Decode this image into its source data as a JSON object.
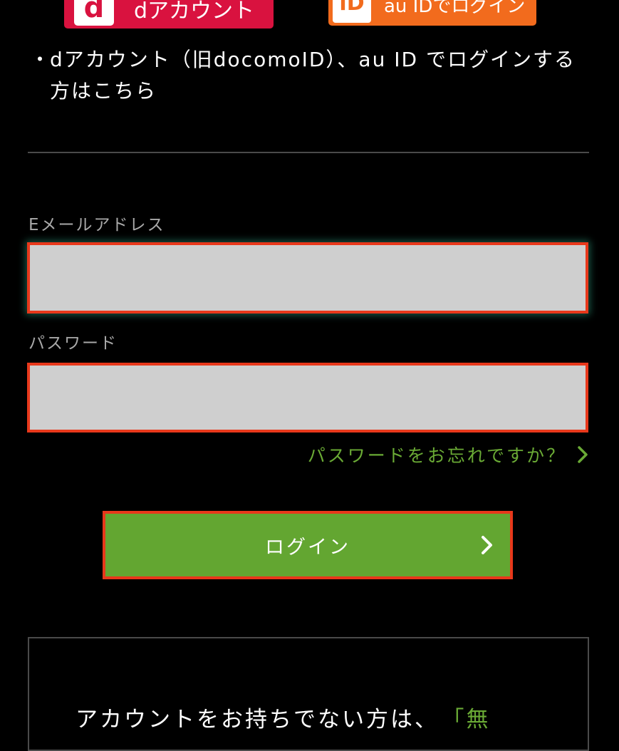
{
  "partner_login": {
    "docomo": {
      "logo_text": "d",
      "label": "dアカウント"
    },
    "au": {
      "logo_text": "iD",
      "label": "au IDでログイン"
    }
  },
  "note": {
    "bullet": "・",
    "text": "dアカウント（旧docomoID）、au ID でログインする方はこちら"
  },
  "form": {
    "email_label": "Eメールアドレス",
    "email_value": "",
    "password_label": "パスワード",
    "password_value": "",
    "forgot_password": "パスワードをお忘れですか？"
  },
  "login_button": {
    "label": "ログイン"
  },
  "signup": {
    "text": "アカウントをお持ちでない方は、",
    "link_text": "「無"
  },
  "colors": {
    "background": "#000000",
    "accent_green": "#63a631",
    "link_green": "#6aaa35",
    "highlight_red": "#e8381b",
    "docomo_red": "#d9123f",
    "au_orange": "#f26b1d"
  },
  "icons": {
    "forgot_chevron": "chevron-right-icon",
    "login_chevron": "chevron-right-icon"
  }
}
